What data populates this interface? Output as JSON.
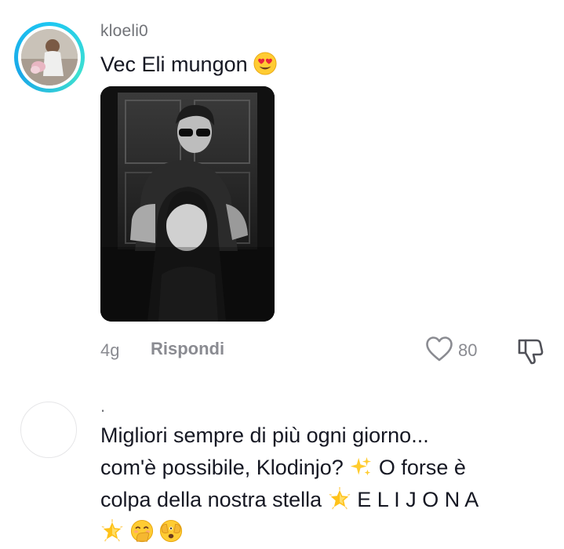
{
  "comments": [
    {
      "username": "kloeli0",
      "text": "Vec Eli mungon",
      "emoji": "heart-eyes-emoji",
      "time": "4g",
      "reply_label": "Rispondi",
      "likes": "80",
      "has_story_ring": true,
      "has_image": true
    },
    {
      "username": ".",
      "text_lines": [
        "Migliori sempre di più ogni giorno...",
        "com'è possibile, Klodinjo?",
        "O forse è",
        "colpa della nostra stella",
        "E L I J O N A"
      ],
      "emojis": [
        "sparkles-emoji",
        "glowing-star-emoji",
        "glowing-star-emoji",
        "hand-over-mouth-emoji",
        "face-with-peeking-eye-emoji"
      ]
    }
  ],
  "colors": {
    "text": "#161823",
    "secondary": "#8a8b91",
    "story_ring": "#1ec7f2"
  }
}
